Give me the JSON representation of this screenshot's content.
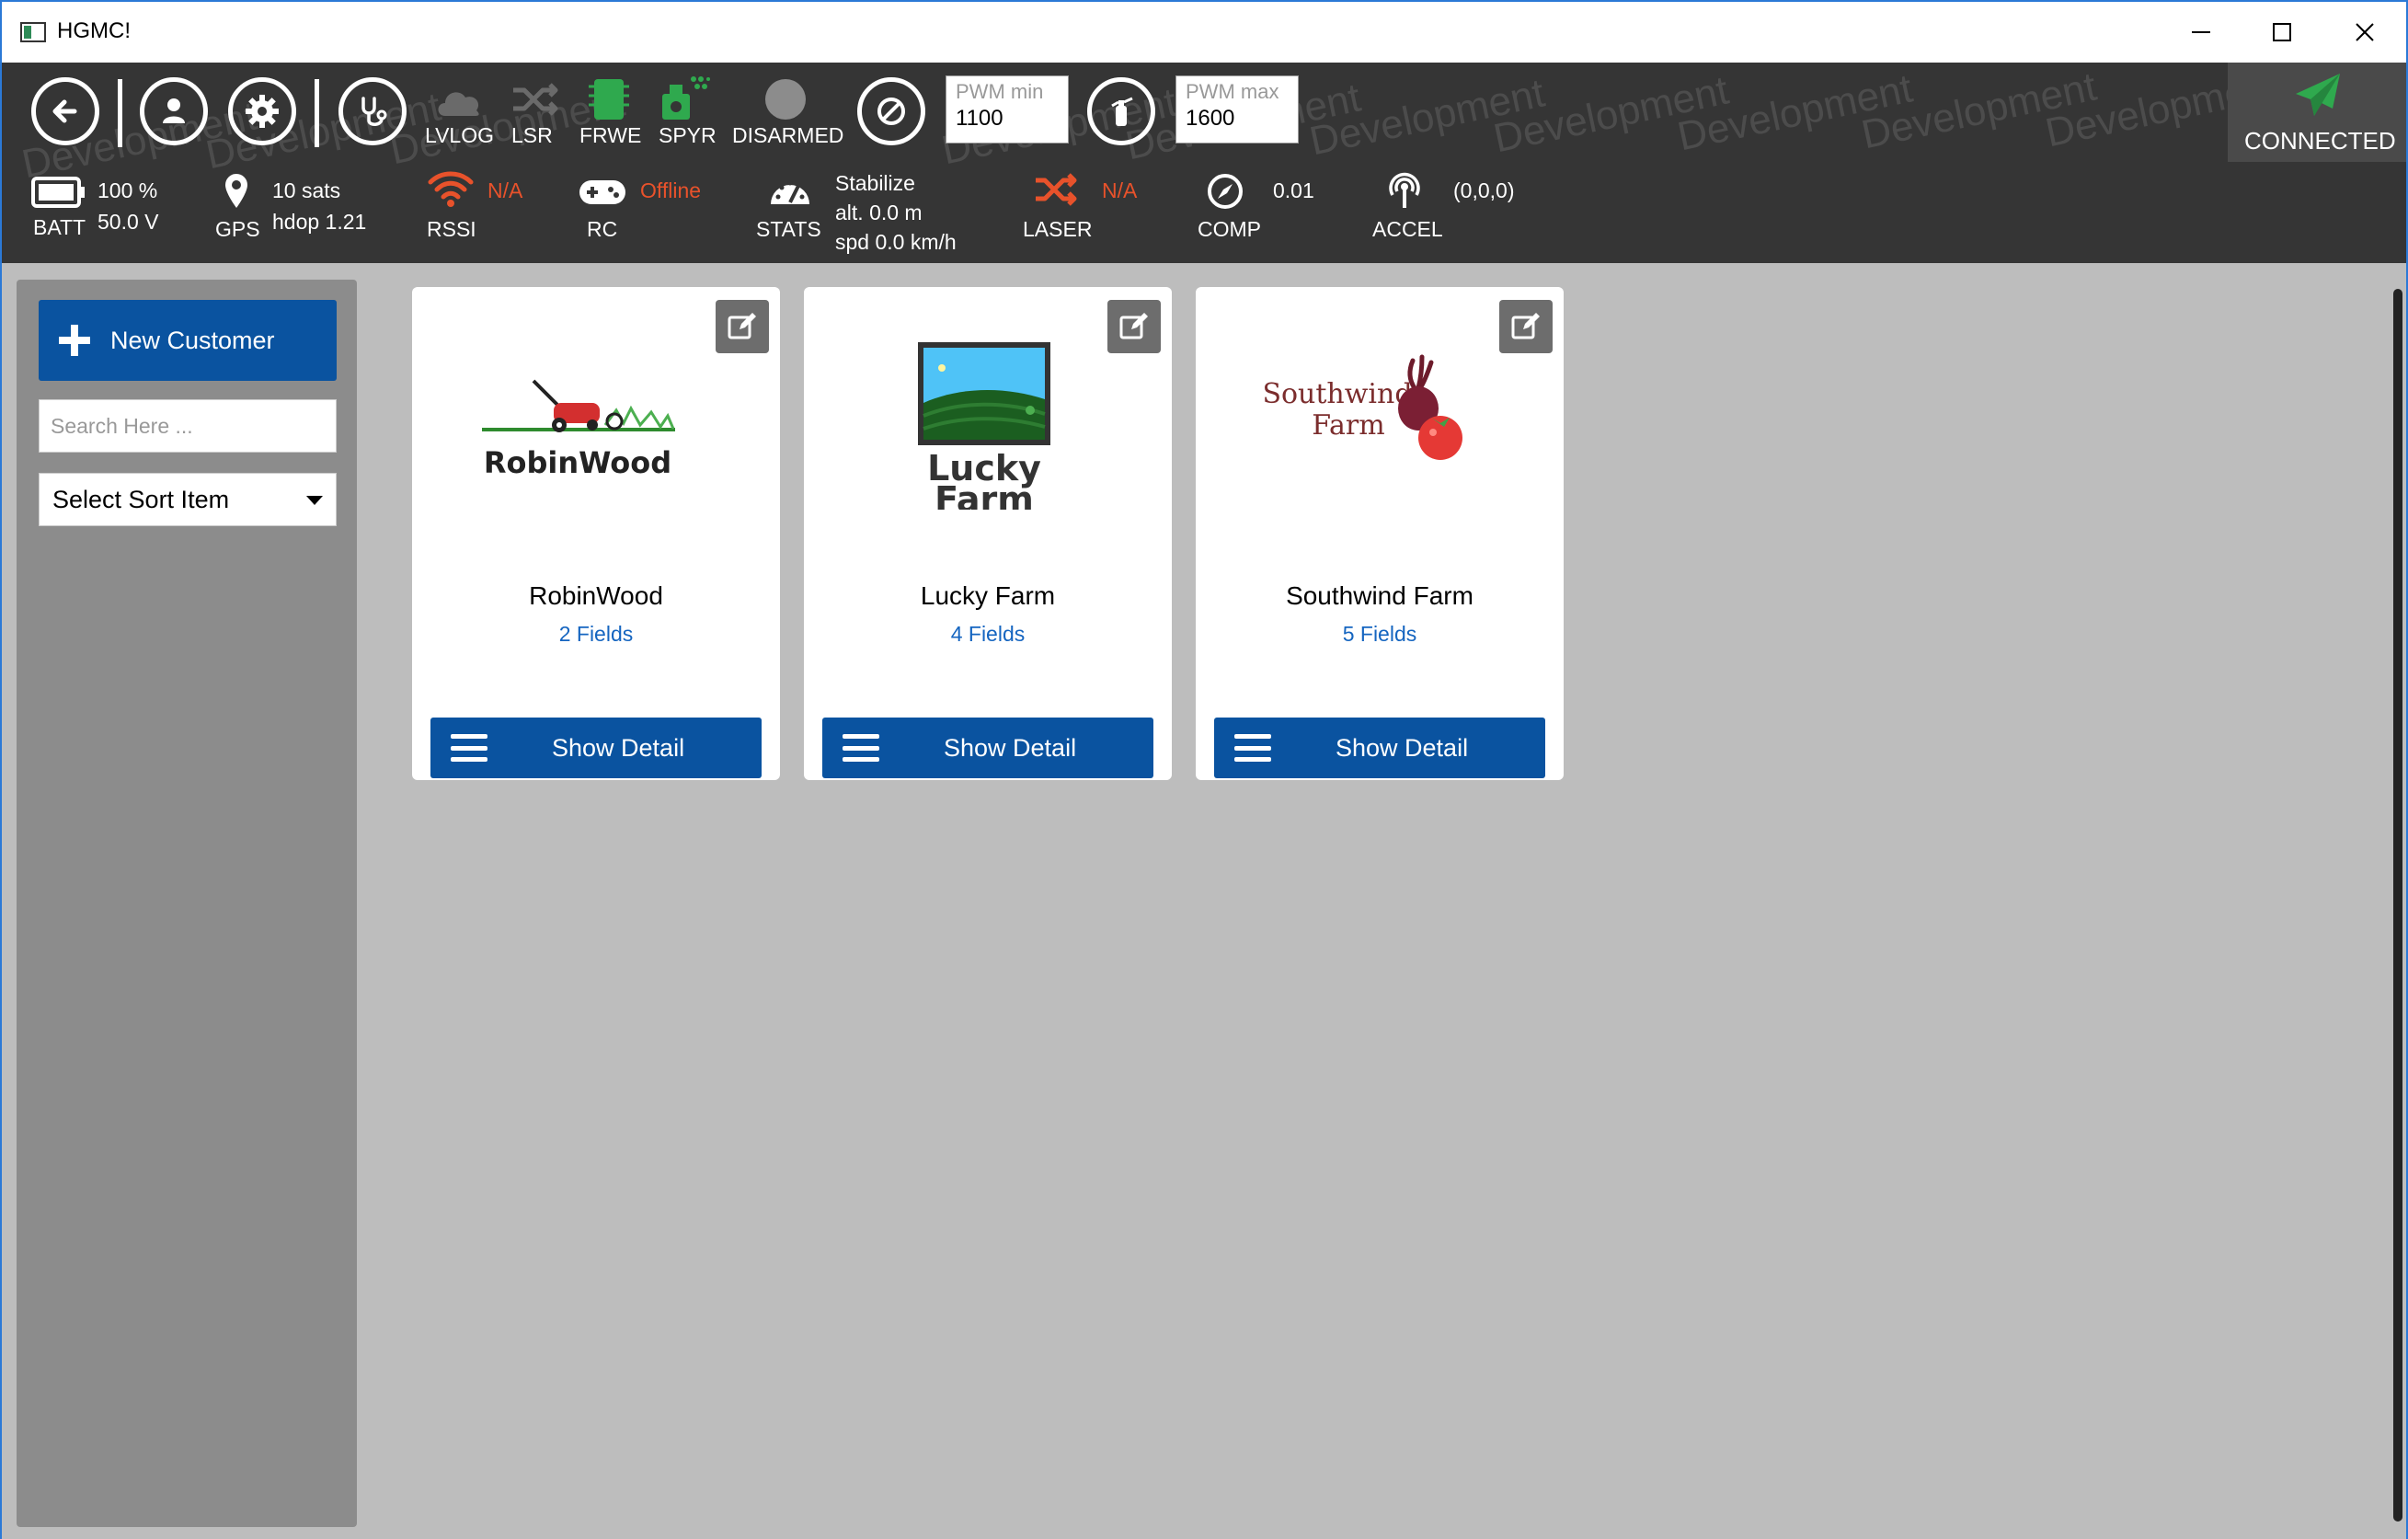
{
  "window": {
    "title": "HGMC!"
  },
  "toolbar": {
    "watermark": "Development",
    "items": {
      "lvlog": "LVLOG",
      "lsr": "LSR",
      "frwe": "FRWE",
      "spyr": "SPYR",
      "armed": "DISARMED"
    },
    "pwm_min": {
      "placeholder": "PWM min",
      "value": "1100"
    },
    "pwm_max": {
      "placeholder": "PWM max",
      "value": "1600"
    },
    "connection": "CONNECTED",
    "colors": {
      "accent_green": "#2fa94e",
      "warning_red": "#e8522b",
      "toolbar_bg": "#353535"
    }
  },
  "status": {
    "batt": {
      "label": "BATT",
      "percent": "100 %",
      "voltage": "50.0 V"
    },
    "gps": {
      "label": "GPS",
      "sats": "10 sats",
      "hdop": "hdop 1.21"
    },
    "rssi": {
      "label": "RSSI",
      "value": "N/A"
    },
    "rc": {
      "label": "RC",
      "value": "Offline"
    },
    "stats": {
      "label": "STATS",
      "mode": "Stabilize",
      "alt": "alt. 0.0 m",
      "spd": "spd 0.0 km/h"
    },
    "laser": {
      "label": "LASER",
      "value": "N/A"
    },
    "comp": {
      "label": "COMP",
      "value": "0.01"
    },
    "accel": {
      "label": "ACCEL",
      "value": "(0,0,0)"
    }
  },
  "sidebar": {
    "new_customer": "New Customer",
    "search_placeholder": "Search Here ...",
    "sort_label": "Select Sort Item"
  },
  "customers": [
    {
      "name": "RobinWood",
      "fields": "2 Fields",
      "detail": "Show Detail",
      "logo_text": "RobinWood"
    },
    {
      "name": "Lucky Farm",
      "fields": "4 Fields",
      "detail": "Show Detail",
      "logo_text_1": "Lucky",
      "logo_text_2": "Farm"
    },
    {
      "name": "Southwind Farm",
      "fields": "5 Fields",
      "detail": "Show Detail",
      "logo_text_1": "Southwind",
      "logo_text_2": "Farm"
    }
  ]
}
